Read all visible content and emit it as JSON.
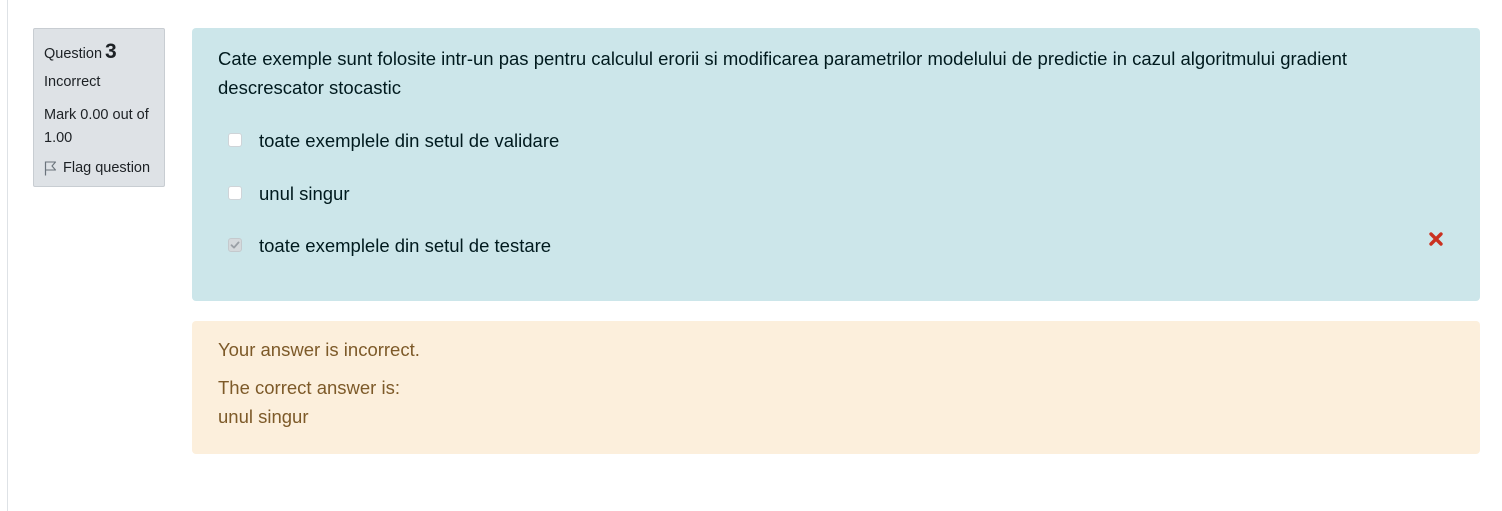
{
  "info": {
    "question_label": "Question",
    "question_number": "3",
    "state": "Incorrect",
    "grade": "Mark 0.00 out of 1.00",
    "flag_label": "Flag question"
  },
  "question": {
    "text": "Cate exemple sunt folosite intr-un pas pentru calculul erorii si modificarea parametrilor modelului de predictie in cazul algoritmului gradient descrescator stocastic",
    "answers": [
      {
        "label": "toate exemplele din setul de validare",
        "checked": false
      },
      {
        "label": "unul singur",
        "checked": false
      },
      {
        "label": "toate exemplele din setul de testare",
        "checked": true,
        "feedback_icon": "incorrect-x-icon"
      }
    ]
  },
  "feedback": {
    "general": "Your answer is incorrect.",
    "correct_prefix": "The correct answer is:",
    "correct_answer": "unul singur"
  },
  "colors": {
    "question_bg": "#cce6ea",
    "feedback_bg": "#fcefdc",
    "info_bg": "#dee2e6",
    "incorrect_mark": "#ca3120"
  }
}
